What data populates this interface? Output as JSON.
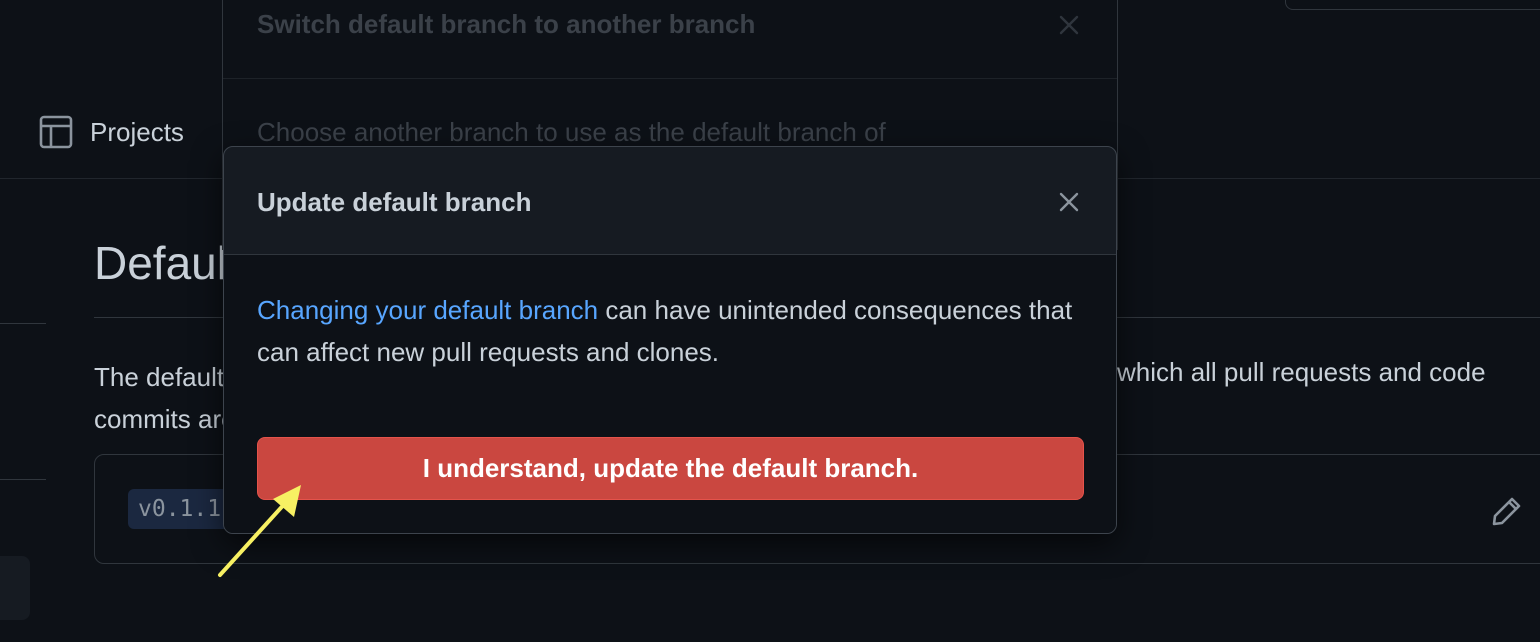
{
  "background": {
    "nav": {
      "projects_label": "Projects",
      "projects_icon": "table-icon"
    },
    "section": {
      "heading": "Default branch",
      "description_left_lines": [
        "The default branch is considered the “base” branch in your repository, against",
        "commits are automatically made, unless you specify a different branch."
      ],
      "description_right": "which all pull requests and code",
      "branch_name": "v0.1.1",
      "edit_icon": "pencil-icon"
    }
  },
  "back_dialog": {
    "title": "Switch default branch to another branch",
    "body": "Choose another branch to use as the default branch of",
    "close_icon": "close-icon"
  },
  "dialog": {
    "title": "Update default branch",
    "close_icon": "close-icon",
    "message_link": "Changing your default branch",
    "message_rest": " can have unintended consequences that can affect new pull requests and clones.",
    "confirm_label": "I understand, update the default branch."
  },
  "annotation": {
    "type": "arrow",
    "color": "#f7f063"
  },
  "colors": {
    "page_bg": "#0d1117",
    "dialog_bg": "#161b22",
    "link": "#58a6ff",
    "danger_button": "#ca4740",
    "text": "#c9d1d9"
  }
}
